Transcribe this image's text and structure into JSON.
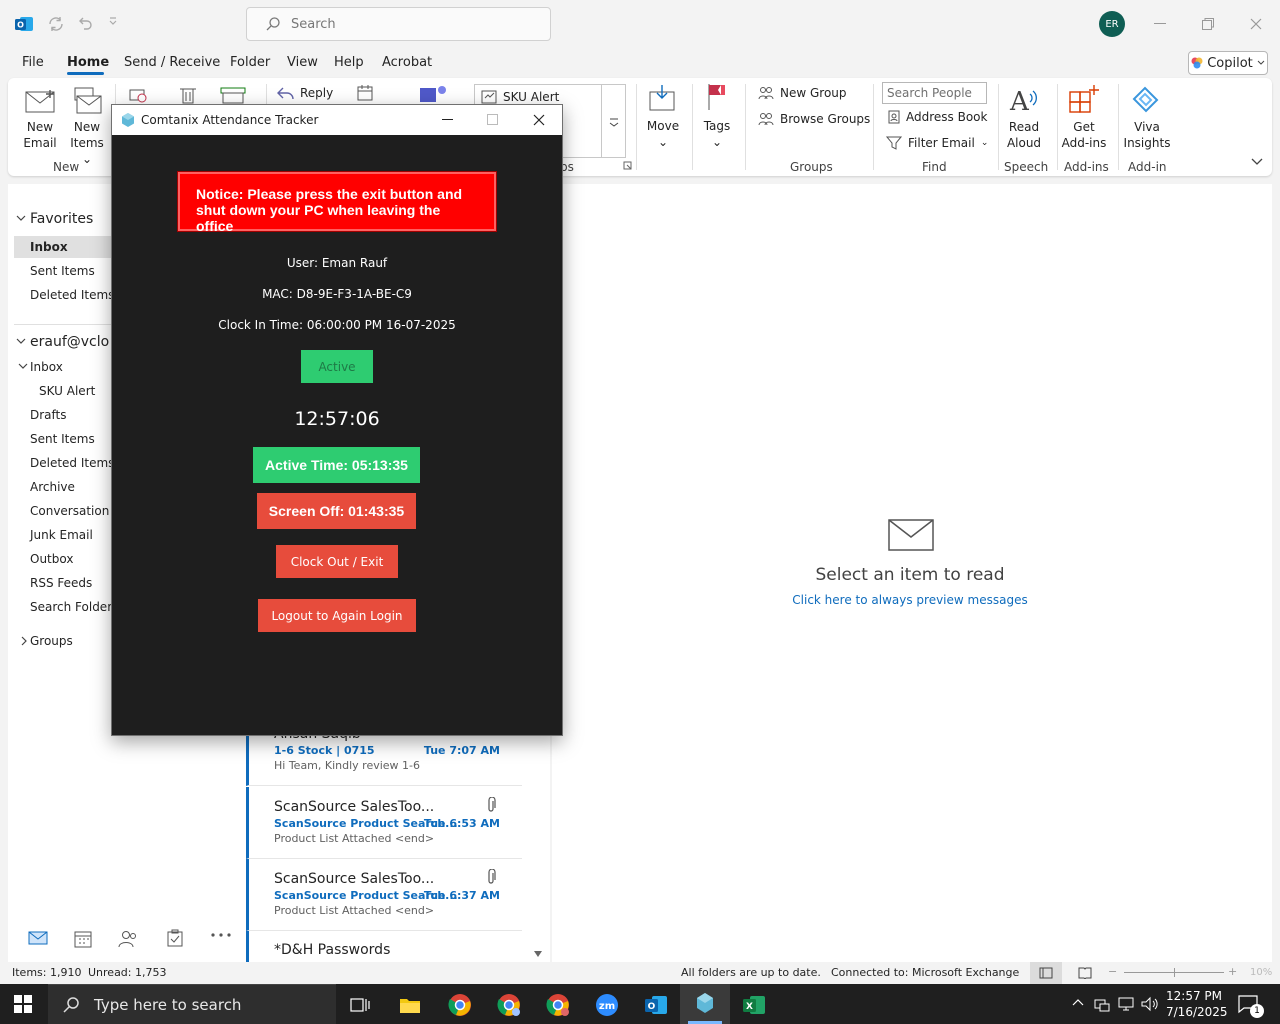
{
  "titlebar": {
    "search_placeholder": "Search",
    "avatar_initials": "ER"
  },
  "menu": {
    "items": [
      "File",
      "Home",
      "Send / Receive",
      "Folder",
      "View",
      "Help",
      "Acrobat"
    ],
    "copilot": "Copilot"
  },
  "ribbon": {
    "new_email": [
      "New",
      "Email"
    ],
    "new_items": [
      "New",
      "Items"
    ],
    "group_new": "New",
    "reply": "Reply",
    "sku_alert": "SKU Alert",
    "group_steps_partial": "ps",
    "move": "Move",
    "tags": "Tags",
    "new_group": "New Group",
    "browse_groups": "Browse Groups",
    "group_groups": "Groups",
    "search_people_placeholder": "Search People",
    "address_book": "Address Book",
    "filter_email": "Filter Email",
    "group_find": "Find",
    "read_aloud": [
      "Read",
      "Aloud"
    ],
    "group_speech": "Speech",
    "get_addins": [
      "Get",
      "Add-ins"
    ],
    "group_addins": "Add-ins",
    "viva_insights": [
      "Viva",
      "Insights"
    ],
    "group_addin": "Add-in"
  },
  "folders": {
    "favorites": "Favorites",
    "fav_items": [
      "Inbox",
      "Sent Items",
      "Deleted Items"
    ],
    "account": "erauf@vclou",
    "inbox": "Inbox",
    "sku_alert": "SKU Alert",
    "items": [
      "Drafts",
      "Sent Items",
      "Deleted Items",
      "Archive",
      "Conversation H",
      "Junk Email",
      "Outbox",
      "RSS Feeds",
      "Search Folders"
    ],
    "groups": "Groups"
  },
  "messages": [
    {
      "from": "Ahsan Saqib",
      "subject": "1-6 Stock | 0715",
      "time": "Tue 7:07 AM",
      "preview": "Hi Team,  Kindly review 1-6"
    },
    {
      "from": "ScanSource SalesToo...",
      "subject": "ScanSource Product Search...",
      "time": "Tue 6:53 AM",
      "preview": "Product List Attached <end>"
    },
    {
      "from": "ScanSource SalesToo...",
      "subject": "ScanSource Product Search...",
      "time": "Tue 6:37 AM",
      "preview": "Product List Attached <end>"
    },
    {
      "from": "*D&H Passwords",
      "subject": "",
      "time": "",
      "preview": ""
    }
  ],
  "reading": {
    "title": "Select an item to read",
    "link": "Click here to always preview messages"
  },
  "status": {
    "items": "Items: 1,910",
    "unread": "Unread: 1,753",
    "sync": "All folders are up to date.",
    "connection": "Connected to: Microsoft Exchange",
    "zoom": "10%"
  },
  "taskbar": {
    "search_placeholder": "Type here to search",
    "time": "12:57 PM",
    "date": "7/16/2025",
    "notif_count": "1"
  },
  "tracker": {
    "title": "Comtanix Attendance Tracker",
    "notice": "Notice: Please press the exit button and shut down your PC when leaving the office",
    "user": "User: Eman Rauf",
    "mac": "MAC: D8-9E-F3-1A-BE-C9",
    "clock_in": "Clock In Time: 06:00:00 PM 16-07-2025",
    "status": "Active",
    "clock": "12:57:06",
    "active_time": "Active Time: 05:13:35",
    "screen_off": "Screen Off: 01:43:35",
    "clock_out": "Clock Out / Exit",
    "logout": "Logout to Again Login"
  },
  "colors": {
    "accent": "#0f6cbd",
    "active_green": "#2ecc71",
    "danger_red": "#e74c3c",
    "notice_red": "#ff0000",
    "dialog_bg": "#1e1e1e"
  }
}
